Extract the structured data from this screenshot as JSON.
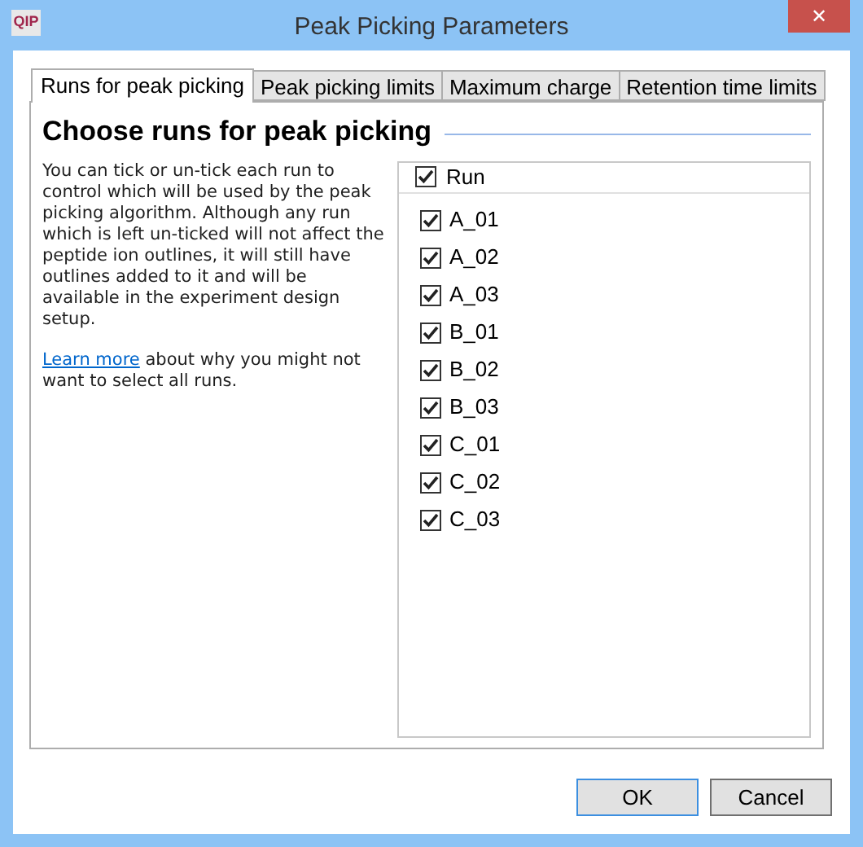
{
  "window": {
    "logo": "QIP",
    "title": "Peak Picking Parameters",
    "close": "✕"
  },
  "tabs": [
    {
      "label": "Runs for peak picking",
      "selected": true
    },
    {
      "label": "Peak picking limits",
      "selected": false
    },
    {
      "label": "Maximum charge",
      "selected": false
    },
    {
      "label": "Retention time limits",
      "selected": false
    }
  ],
  "heading": "Choose runs for peak picking",
  "description": "You can tick or un-tick each run to control which will be used by the peak picking algorithm. Although any run which is left un-ticked will not affect the peptide ion outlines, it will still have outlines added to it and will be available in the experiment design setup.",
  "learn_more": {
    "link": "Learn more",
    "text": "about why you might not want to select all runs."
  },
  "runs": {
    "header": {
      "label": "Run",
      "checked": true
    },
    "items": [
      {
        "label": "A_01",
        "checked": true
      },
      {
        "label": "A_02",
        "checked": true
      },
      {
        "label": "A_03",
        "checked": true
      },
      {
        "label": "B_01",
        "checked": true
      },
      {
        "label": "B_02",
        "checked": true
      },
      {
        "label": "B_03",
        "checked": true
      },
      {
        "label": "C_01",
        "checked": true
      },
      {
        "label": "C_02",
        "checked": true
      },
      {
        "label": "C_03",
        "checked": true
      }
    ]
  },
  "buttons": [
    {
      "label": "OK",
      "selected": true
    },
    {
      "label": "Cancel",
      "selected": false
    }
  ]
}
